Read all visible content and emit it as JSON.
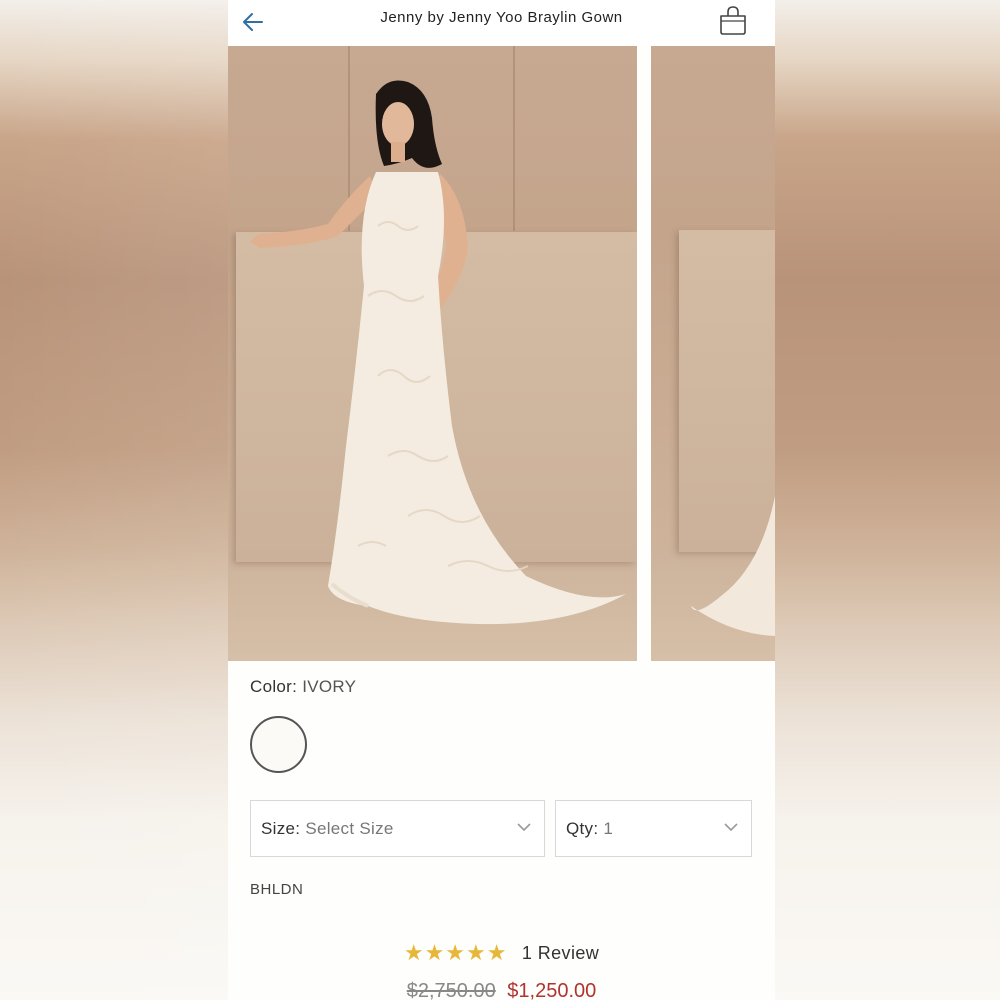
{
  "header": {
    "title": "Jenny by Jenny Yoo Braylin Gown",
    "back_icon": "arrow-left-icon",
    "bag_icon": "shopping-bag-icon"
  },
  "product": {
    "color_label": "Color:",
    "color_value": "IVORY",
    "swatch_color": "#fbfaf7",
    "size_label": "Size:",
    "size_value": "Select Size",
    "qty_label": "Qty:",
    "qty_value": "1",
    "brand": "BHLDN",
    "stars": "★★★★★",
    "rating": 5,
    "reviews": "1 Review",
    "price_original": "$2,750.00",
    "price_sale": "$1,250.00"
  },
  "colors": {
    "accent": "#2f6fa3",
    "sale": "#b0342e",
    "star": "#e7b73a"
  }
}
